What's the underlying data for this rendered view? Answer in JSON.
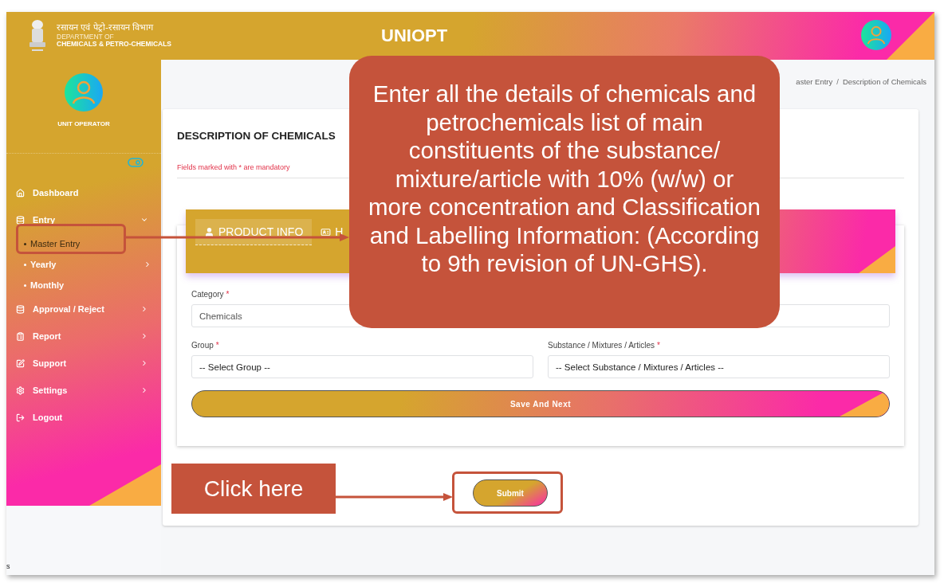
{
  "header": {
    "dept_hindi": "रसायन एवं पेट्रो-रसायन विभाग",
    "dept_line1": "DEPARTMENT OF",
    "dept_line2": "CHEMICALS & PETRO-CHEMICALS",
    "title": "UNIOPT"
  },
  "sidebar": {
    "role": "UNIT OPERATOR",
    "items": [
      {
        "kind": "home",
        "label": "Dashboard",
        "selected": false
      },
      {
        "kind": "entry",
        "label": "Entry",
        "selected": false,
        "expanded": true,
        "children": [
          {
            "label": "Master Entry",
            "selected": true
          },
          {
            "label": "Yearly",
            "selected": false,
            "expanded": false
          },
          {
            "label": "Monthly",
            "selected": false
          }
        ]
      },
      {
        "kind": "database",
        "label": "Approval / Reject",
        "selected": false,
        "expanded": false
      },
      {
        "kind": "report",
        "label": "Report",
        "selected": false,
        "expanded": false
      },
      {
        "kind": "support",
        "label": "Support",
        "selected": false,
        "expanded": false
      },
      {
        "kind": "settings",
        "label": "Settings",
        "selected": false,
        "expanded": false
      },
      {
        "kind": "logout",
        "label": "Logout",
        "selected": false
      }
    ],
    "footer_text": "s"
  },
  "breadcrumb": {
    "items": [
      "aster Entry",
      "Description of Chemicals"
    ],
    "separator": "/"
  },
  "page": {
    "title": "DESCRIPTION OF CHEMICALS",
    "mandatory_note": "Fields marked with * are mandatory"
  },
  "tabs": [
    {
      "kind": "user",
      "label": "PRODUCT INFO",
      "selected": true
    },
    {
      "kind": "card",
      "label": "H",
      "selected": false
    }
  ],
  "form": {
    "fields": [
      {
        "kind": "text",
        "label": "Category",
        "required": true,
        "value": "Chemicals"
      },
      {
        "kind": "text"
      },
      {
        "kind": "select",
        "label": "Group",
        "required": true,
        "value": "-- Select Group --"
      },
      {
        "kind": "select",
        "label": "Substance / Mixtures / Articles",
        "required": true,
        "value": "-- Select Substance / Mixtures / Articles --"
      }
    ],
    "required_mark": "*",
    "save_button": "Save And Next",
    "submit_button": "Submit"
  },
  "annotations": {
    "callout": "Enter all the details of chemicals and petrochemicals list of main constituents of the substance/ mixture/article with 10% (w/w) or more concentration and Classification and Labelling Information: (According to 9th revision of UN-GHS).",
    "click_label": "Click here"
  }
}
